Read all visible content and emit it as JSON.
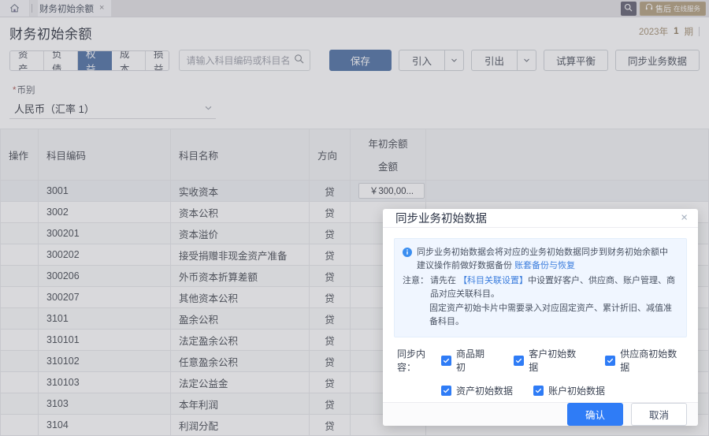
{
  "tabstrip": {
    "home_icon": "home-icon",
    "tab_label": "财务初始余额",
    "close_glyph": "×",
    "search_icon": "search-icon",
    "service_label": "售后",
    "service_sub": "在线服务",
    "service_icon": "headset-icon"
  },
  "header": {
    "title": "财务初始余额",
    "period_year": "2023年",
    "period_num": "1",
    "period_unit": "期"
  },
  "toolbar": {
    "segments": [
      {
        "label": "资产",
        "active": false
      },
      {
        "label": "负债",
        "active": false
      },
      {
        "label": "权益",
        "active": true
      },
      {
        "label": "成本",
        "active": false
      },
      {
        "label": "损益",
        "active": false
      }
    ],
    "search_placeholder": "请输入科目编码或科目名称",
    "search_value": "",
    "save_label": "保存",
    "import_label": "引入",
    "export_label": "引出",
    "trial_balance_label": "试算平衡",
    "sync_biz_label": "同步业务数据"
  },
  "currency": {
    "label": "币别",
    "required_mark": "*",
    "value": "人民币（汇率 1）"
  },
  "table": {
    "columns": {
      "op": "操作",
      "code": "科目编码",
      "name": "科目名称",
      "direction": "方向",
      "amount_top": "年初余额",
      "amount_bottom": "金额"
    },
    "rows": [
      {
        "code": "3001",
        "name": "实收资本",
        "dir": "贷",
        "amount": "￥300,00...",
        "has_input": true,
        "selected": true
      },
      {
        "code": "3002",
        "name": "资本公积",
        "dir": "贷",
        "amount": "",
        "has_input": false,
        "selected": false
      },
      {
        "code": "300201",
        "name": "资本溢价",
        "dir": "贷",
        "amount": "",
        "has_input": false,
        "selected": false
      },
      {
        "code": "300202",
        "name": "接受捐赠非现金资产准备",
        "dir": "贷",
        "amount": "",
        "has_input": false,
        "selected": false
      },
      {
        "code": "300206",
        "name": "外币资本折算差额",
        "dir": "贷",
        "amount": "",
        "has_input": false,
        "selected": false
      },
      {
        "code": "300207",
        "name": "其他资本公积",
        "dir": "贷",
        "amount": "",
        "has_input": false,
        "selected": false
      },
      {
        "code": "3101",
        "name": "盈余公积",
        "dir": "贷",
        "amount": "",
        "has_input": false,
        "selected": false
      },
      {
        "code": "310101",
        "name": "法定盈余公积",
        "dir": "贷",
        "amount": "",
        "has_input": false,
        "selected": false
      },
      {
        "code": "310102",
        "name": "任意盈余公积",
        "dir": "贷",
        "amount": "",
        "has_input": false,
        "selected": false
      },
      {
        "code": "310103",
        "name": "法定公益金",
        "dir": "贷",
        "amount": "",
        "has_input": false,
        "selected": false
      },
      {
        "code": "3103",
        "name": "本年利润",
        "dir": "贷",
        "amount": "",
        "has_input": false,
        "selected": false
      },
      {
        "code": "3104",
        "name": "利润分配",
        "dir": "贷",
        "amount": "",
        "has_input": false,
        "selected": false
      }
    ]
  },
  "modal": {
    "title": "同步业务初始数据",
    "close_glyph": "×",
    "notice": {
      "line1": "同步业务初始数据会将对应的业务初始数据同步到财务初始余额中",
      "line2_text": "建议操作前做好数据备份",
      "line2_link": "账套备份与恢复",
      "note_label": "注意：",
      "note_text_a": "请先在",
      "note_link": "【科目关联设置】",
      "note_text_b": "中设置好客户、供应商、账户管理、商品对应关联科目。",
      "line3": "固定资产初始卡片中需要录入对应固定资产、累计折旧、减值准备科目。"
    },
    "sync_label": "同步内容：",
    "options_row1": [
      {
        "label": "商品期初",
        "checked": true
      },
      {
        "label": "客户初始数据",
        "checked": true
      },
      {
        "label": "供应商初始数据",
        "checked": true
      }
    ],
    "options_row2": [
      {
        "label": "资产初始数据",
        "checked": true
      },
      {
        "label": "账户初始数据",
        "checked": true
      }
    ],
    "confirm_label": "确认",
    "cancel_label": "取消"
  },
  "colors": {
    "primary": "#2f6fd0",
    "modal_primary": "#2f7cf6",
    "link": "#3b7ddd",
    "period": "#b08a52",
    "service": "#c09b5e"
  }
}
